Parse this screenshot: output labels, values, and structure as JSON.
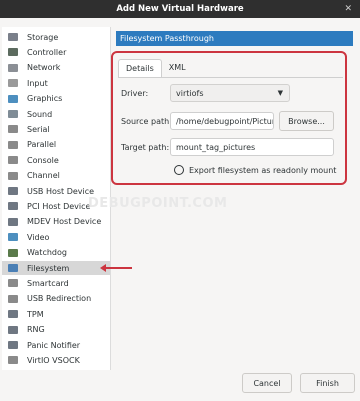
{
  "window": {
    "title": "Add New Virtual Hardware",
    "close_glyph": "✕"
  },
  "hardware_list": [
    {
      "label": "Storage",
      "icon": "storage-icon",
      "color": "#7a7f8a"
    },
    {
      "label": "Controller",
      "icon": "controller-icon",
      "color": "#5c6b5f"
    },
    {
      "label": "Network",
      "icon": "network-icon",
      "color": "#8b8f95"
    },
    {
      "label": "Input",
      "icon": "input-icon",
      "color": "#9a9a9a"
    },
    {
      "label": "Graphics",
      "icon": "graphics-icon",
      "color": "#4d8fbf"
    },
    {
      "label": "Sound",
      "icon": "sound-icon",
      "color": "#7f8c96"
    },
    {
      "label": "Serial",
      "icon": "serial-icon",
      "color": "#8a8a8a"
    },
    {
      "label": "Parallel",
      "icon": "parallel-icon",
      "color": "#8a8a8a"
    },
    {
      "label": "Console",
      "icon": "console-icon",
      "color": "#8a8a8a"
    },
    {
      "label": "Channel",
      "icon": "channel-icon",
      "color": "#8a8a8a"
    },
    {
      "label": "USB Host Device",
      "icon": "usb-host-icon",
      "color": "#6f7782"
    },
    {
      "label": "PCI Host Device",
      "icon": "pci-host-icon",
      "color": "#6f7782"
    },
    {
      "label": "MDEV Host Device",
      "icon": "mdev-host-icon",
      "color": "#6f7782"
    },
    {
      "label": "Video",
      "icon": "video-icon",
      "color": "#4d8fbf"
    },
    {
      "label": "Watchdog",
      "icon": "watchdog-icon",
      "color": "#5a7a4a"
    },
    {
      "label": "Filesystem",
      "icon": "filesystem-icon",
      "color": "#4a7fb5"
    },
    {
      "label": "Smartcard",
      "icon": "smartcard-icon",
      "color": "#8a8a8a"
    },
    {
      "label": "USB Redirection",
      "icon": "usb-redirection-icon",
      "color": "#8a8a8a"
    },
    {
      "label": "TPM",
      "icon": "tpm-icon",
      "color": "#6f7782"
    },
    {
      "label": "RNG",
      "icon": "rng-icon",
      "color": "#6f7782"
    },
    {
      "label": "Panic Notifier",
      "icon": "panic-notifier-icon",
      "color": "#6f7782"
    },
    {
      "label": "VirtIO VSOCK",
      "icon": "vsock-icon",
      "color": "#8a8a8a"
    }
  ],
  "selected_item": "Filesystem",
  "panel": {
    "header": "Filesystem Passthrough",
    "tabs": [
      "Details",
      "XML"
    ],
    "active_tab": "Details",
    "driver_label": "Driver:",
    "driver_value": "virtiofs",
    "source_label": "Source path:",
    "source_value": "/home/debugpoint/Pictures",
    "browse_label": "Browse...",
    "target_label": "Target path:",
    "target_value": "mount_tag_pictures",
    "readonly_label": "Export filesystem as readonly mount"
  },
  "watermark": "DEBUGPOINT.COM",
  "footer": {
    "cancel": "Cancel",
    "finish": "Finish"
  },
  "colors": {
    "header_bg": "#2d7bbf",
    "highlight_border": "#cc3540",
    "titlebar_bg": "#2f2f2f"
  }
}
